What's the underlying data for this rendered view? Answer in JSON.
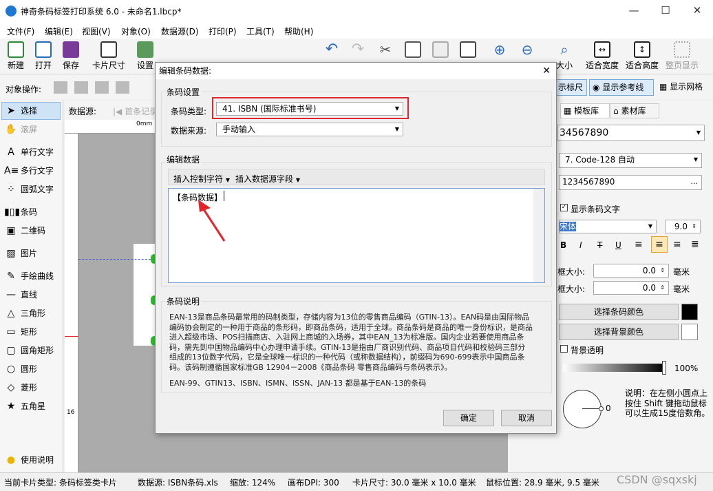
{
  "window": {
    "title": "神奇条码标签打印系统 6.0 - 未命名1.lbcp*",
    "minimize": "—",
    "maximize": "☐",
    "close": "✕"
  },
  "menu": [
    "文件(F)",
    "编辑(E)",
    "视图(V)",
    "对象(O)",
    "数据源(D)",
    "打印(P)",
    "工具(T)",
    "帮助(H)"
  ],
  "toolbar": {
    "new": "新建",
    "open": "打开",
    "save": "保存",
    "card_size": "卡片尺寸",
    "settings": "设置",
    "zoom_partial": "大小",
    "fit_width": "适合宽度",
    "fit_height": "适合高度",
    "full_page": "整页显示"
  },
  "objbar": {
    "label": "对象操作:",
    "show_ruler": "示标尺",
    "show_guides": "显示参考线",
    "show_grid": "显示网格"
  },
  "datasource_bar": {
    "label": "数据源:",
    "first": "首条记录"
  },
  "tools": [
    "选择",
    "滚屏",
    "单行文字",
    "多行文字",
    "圆弧文字",
    "条码",
    "二维码",
    "图片",
    "手绘曲线",
    "直线",
    "三角形",
    "矩形",
    "圆角矩形",
    "圆形",
    "菱形",
    "五角星",
    "使用说明"
  ],
  "ruler": {
    "origin": "0mm",
    "mark": "16"
  },
  "right": {
    "tab_templates": "模板库",
    "tab_materials": "素材库",
    "data_value": "34567890",
    "barcode_type": "7. Code-128 自动",
    "data_preview": "1234567890",
    "more": "...",
    "show_text": "显示条码文字",
    "font": "宋体",
    "font_size": "9.0",
    "b": "B",
    "i": "I",
    "s": "T",
    "u": "U",
    "label_a": "框大小:",
    "val_a": "0.0",
    "unit_a": "毫米",
    "label_b": "框大小:",
    "val_b": "0.0",
    "unit_b": "毫米",
    "barcode_color": "选择条码颜色",
    "bg_color": "选择背景颜色",
    "bg_transparent": "背景透明",
    "opacity": "100%",
    "angle": "0",
    "hint": "说明：在左侧小圆点上按住 Shift 键拖动鼠标可以生成15度倍数角。"
  },
  "dialog": {
    "title": "编辑条码数据:",
    "close": "✕",
    "group_settings": "条码设置",
    "type_label": "条码类型:",
    "type_value": "41. ISBN (国际标准书号)",
    "source_label": "数据来源:",
    "source_value": "手动输入",
    "group_edit": "编辑数据",
    "insert_ctrl": "插入控制字符",
    "insert_field": "插入数据源字段",
    "text_value": "【条码数据】",
    "group_desc": "条码说明",
    "description": "EAN-13是商品条码最常用的码制类型，存储内容为13位的零售商品编码（GTIN-13）。EAN码是由国际物品编码协会制定的一种用于商品的条形码，即商品条码，适用于全球。商品条码是商品的唯一身份标识，是商品进入超级市场、POS扫描商店、入驻网上商城的入场券，其中EAN_13为标准版。国内企业若要使用商品条码，需先到中国物品编码中心办理申请手续。GTIN-13是指由厂商识别代码、商品项目代码和校验码三部分组成的13位数字代码，它是全球唯一标识的一种代码（或称数据结构），前缀码为690-699表示中国商品条码。该码制遵循国家标准GB 12904－2008《商品条码 零售商品编码与条码表示》。",
    "description2": "EAN-99、GTIN13、ISBN、ISMN、ISSN、JAN-13 都是基于EAN-13的条码",
    "ok": "确定",
    "cancel": "取消"
  },
  "status": {
    "card_type": "当前卡片类型: 条码标签类卡片",
    "datasource": "数据源: ISBN条码.xls",
    "zoom": "缩放: 124%",
    "dpi": "画布DPI: 300",
    "card_size": "卡片尺寸: 30.0 毫米 x 10.0 毫米",
    "mouse": "鼠标位置: 28.9 毫米, 9.5 毫米",
    "watermark": "CSDN @sqxskj"
  },
  "colors": {
    "accent": "#1e78d2",
    "highlight_box": "#e0262c",
    "arrow": "#e0262c"
  }
}
